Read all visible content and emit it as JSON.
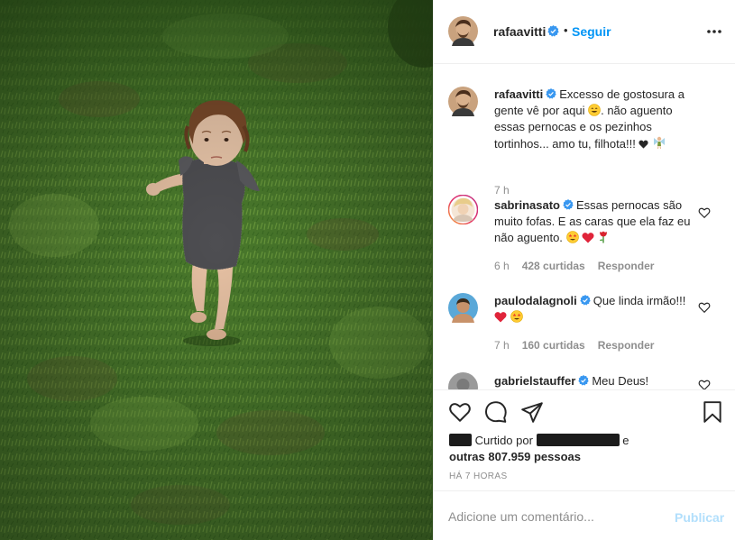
{
  "post": {
    "author": "rafaavitti",
    "follow_label": "Seguir",
    "dot": "•",
    "caption": {
      "username": "rafaavitti",
      "part1": "Excesso de gostosura a gente vê por aqui",
      "part2": ". não aguento essas pernocas e os pezinhos tortinhos... amo tu, filhota!!!",
      "time": "7 h"
    }
  },
  "comments": [
    {
      "username": "sabrinasato",
      "text": "Essas pernocas são muito fofas. E as caras que ela faz eu não aguento.",
      "time": "6 h",
      "likes": "428 curtidas",
      "reply": "Responder"
    },
    {
      "username": "paulodalagnoli",
      "text": "Que linda irmão!!!",
      "time": "7 h",
      "likes": "160 curtidas",
      "reply": "Responder"
    },
    {
      "username": "gabrielstauffer",
      "text": "Meu Deus!"
    }
  ],
  "likes_summary": {
    "prefix": "Curtido por",
    "suffix": "e",
    "others": "outras 807.959 pessoas"
  },
  "time_ago": "HÁ 7 HORAS",
  "add_comment": {
    "placeholder": "Adicione um comentário...",
    "publish_label": "Publicar"
  },
  "colors": {
    "accent": "#0095f6",
    "verified": "#3897f0",
    "heart_red": "#ed4956",
    "muted": "#8e8e8e"
  },
  "icons": {
    "more": "more-options-icon",
    "like": "heart-icon",
    "comment": "comment-icon",
    "share": "share-icon",
    "save": "bookmark-icon"
  }
}
